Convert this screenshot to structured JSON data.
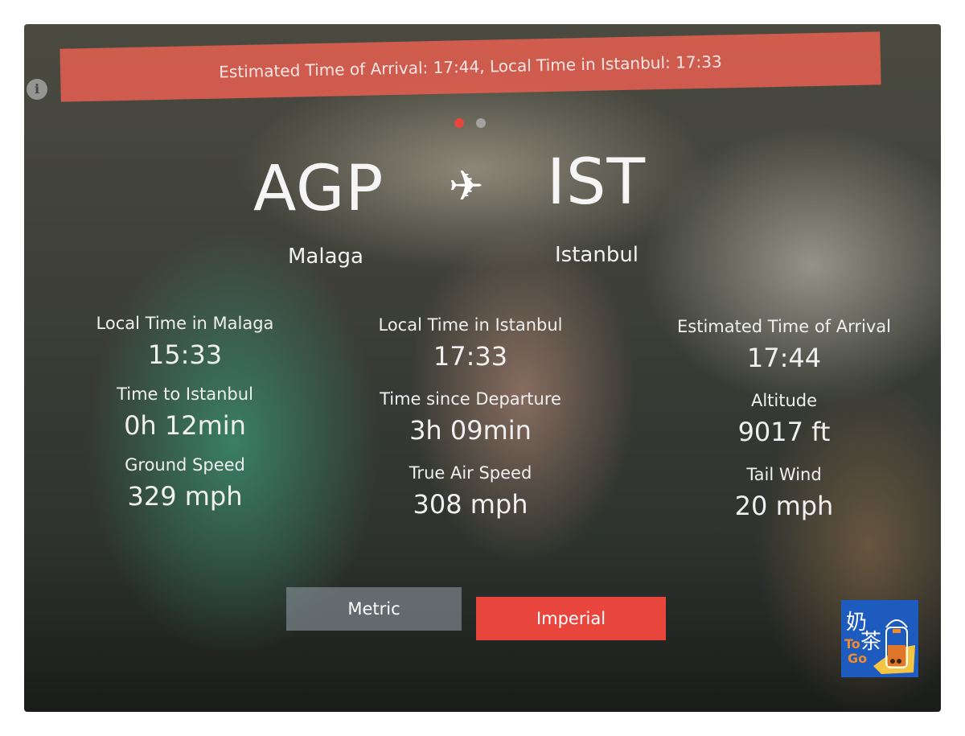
{
  "banner": "Estimated Time of Arrival: 17:44, Local Time in Istanbul: 17:33",
  "route": {
    "origin_code": "AGP",
    "origin_city": "Malaga",
    "destination_code": "IST",
    "destination_city": "Istanbul",
    "icon": "airplane-icon"
  },
  "pager": {
    "pages": 2,
    "active": 1,
    "active_color": "#e8453c"
  },
  "stats": [
    [
      {
        "label": "Local Time in Malaga",
        "value": "15:33"
      },
      {
        "label": "Time to Istanbul",
        "value": "0h 12min"
      },
      {
        "label": "Ground Speed",
        "value": "329 mph"
      }
    ],
    [
      {
        "label": "Local Time in Istanbul",
        "value": "17:33"
      },
      {
        "label": "Time since Departure",
        "value": "3h 09min"
      },
      {
        "label": "True Air Speed",
        "value": "308 mph"
      }
    ],
    [
      {
        "label": "Estimated Time of Arrival",
        "value": "17:44"
      },
      {
        "label": "Altitude",
        "value": "9017 ft"
      },
      {
        "label": "Tail Wind",
        "value": "20 mph"
      }
    ]
  ],
  "units": {
    "metric": "Metric",
    "imperial": "Imperial",
    "selected": "Imperial"
  },
  "accent": "#e8453c",
  "watermark": {
    "text": "奶茶 To Go"
  }
}
